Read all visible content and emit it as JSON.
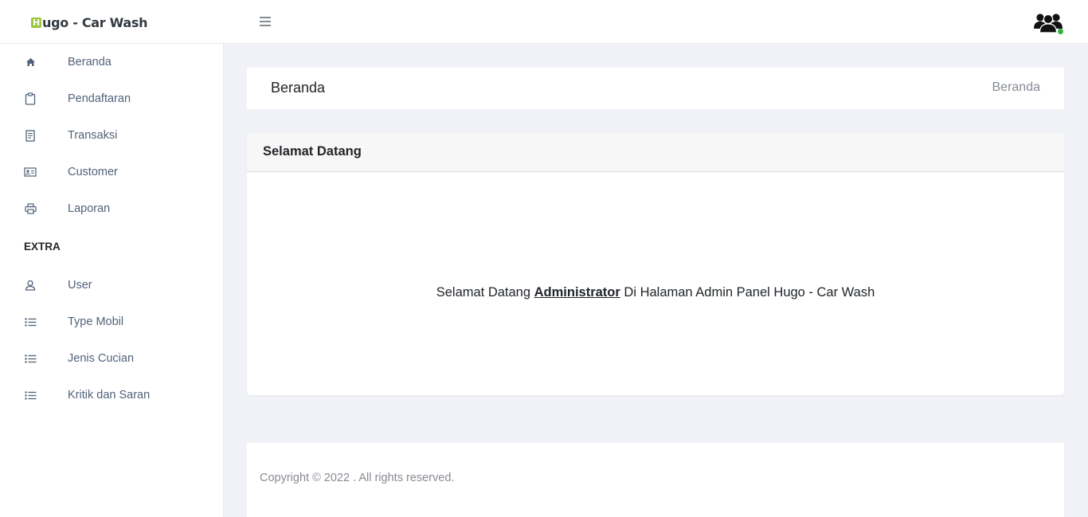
{
  "app": {
    "brand_initial": "H",
    "brand_rest": "ugo - Car Wash",
    "accent_color": "#9bc53d",
    "online_status_color": "#2fb344"
  },
  "sidebar": {
    "items": [
      {
        "label": "Beranda",
        "icon": "home-icon"
      },
      {
        "label": "Pendaftaran",
        "icon": "clipboard-icon"
      },
      {
        "label": "Transaksi",
        "icon": "receipt-icon"
      },
      {
        "label": "Customer",
        "icon": "id-card-icon"
      },
      {
        "label": "Laporan",
        "icon": "printer-icon"
      }
    ],
    "section_label": "EXTRA",
    "extra_items": [
      {
        "label": "User",
        "icon": "user-icon"
      },
      {
        "label": "Type Mobil",
        "icon": "list-icon"
      },
      {
        "label": "Jenis Cucian",
        "icon": "list-icon"
      },
      {
        "label": "Kritik dan Saran",
        "icon": "list-icon"
      }
    ]
  },
  "header": {
    "title": "Beranda",
    "breadcrumb": "Beranda"
  },
  "card": {
    "title": "Selamat Datang",
    "message_before": "Selamat Datang ",
    "admin_name": "Administrator",
    "message_after": " Di Halaman Admin Panel Hugo - Car Wash"
  },
  "footer": {
    "text": "Copyright © 2022 . All rights reserved."
  }
}
